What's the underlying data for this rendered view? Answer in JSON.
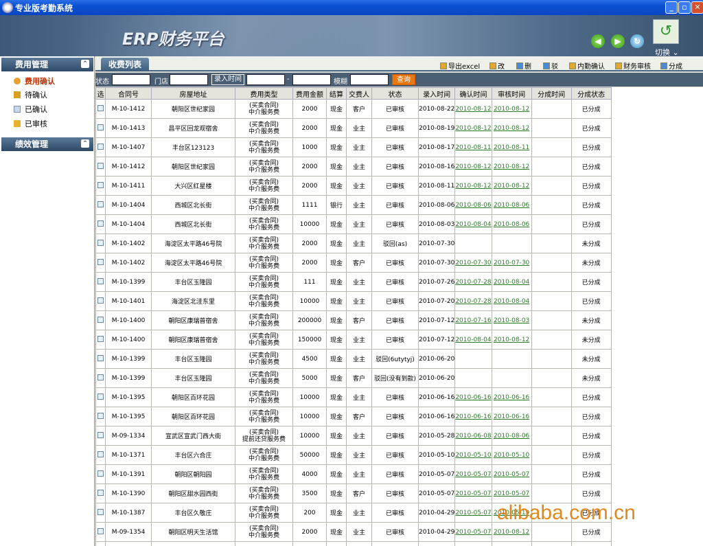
{
  "window": {
    "title": "专业版考勤系统"
  },
  "banner": {
    "brand": "ERP财务平台",
    "switch_label": "切换 ⌄"
  },
  "sidebar": {
    "sections": [
      {
        "label": "费用管理",
        "items": [
          {
            "label": "费用确认",
            "active": true
          },
          {
            "label": "待确认",
            "active": false
          },
          {
            "label": "已确认",
            "active": false
          },
          {
            "label": "已审核",
            "active": false
          }
        ]
      },
      {
        "label": "绩效管理",
        "items": []
      }
    ]
  },
  "tab": {
    "label": "收费列表"
  },
  "toolbar": [
    {
      "label": "导出excel"
    },
    {
      "label": "改"
    },
    {
      "label": "删"
    },
    {
      "label": "驳"
    },
    {
      "label": "内勤确认"
    },
    {
      "label": "财务审核"
    },
    {
      "label": "分成"
    }
  ],
  "filters": {
    "status_label": "状态",
    "store_label": "门店",
    "entry_time_label": "录入时间",
    "dash": "-",
    "fuzzy_label": "模糊",
    "query_label": "查询"
  },
  "table": {
    "headers": [
      "选",
      "合同号",
      "房屋地址",
      "费用类型",
      "费用金额",
      "结算",
      "交费人",
      "状态",
      "录入时间",
      "确认时间",
      "审核时间",
      "分成时间",
      "分成状态"
    ],
    "rows": [
      [
        "M-10-1412",
        "朝阳区世纪家园",
        "(买卖合同)\n中介服务费",
        "2000",
        "现金",
        "客户",
        "已审核",
        "2010-08-22",
        "2010-08-12",
        "2010-08-12",
        "",
        "已分成"
      ],
      [
        "M-10-1413",
        "昌平区回龙观宿舍",
        "(买卖合同)\n中介服务费",
        "2000",
        "现金",
        "业主",
        "已审核",
        "2010-08-19",
        "2010-08-12",
        "2010-08-12",
        "",
        "已分成"
      ],
      [
        "M-10-1407",
        "丰台区123123",
        "(买卖合同)\n中介服务费",
        "1000",
        "现金",
        "业主",
        "已审核",
        "2010-08-17",
        "2010-08-11",
        "2010-08-11",
        "",
        "已分成"
      ],
      [
        "M-10-1412",
        "朝阳区世纪家园",
        "(买卖合同)\n中介服务费",
        "2000",
        "现金",
        "业主",
        "已审核",
        "2010-08-16",
        "2010-08-12",
        "2010-08-12",
        "",
        "已分成"
      ],
      [
        "M-10-1411",
        "大兴区红星楼",
        "(买卖合同)\n中介服务费",
        "2000",
        "现金",
        "业主",
        "已审核",
        "2010-08-11",
        "2010-08-12",
        "2010-08-12",
        "",
        "已分成"
      ],
      [
        "M-10-1404",
        "西城区北长街",
        "(买卖合同)\n中介服务费",
        "1111",
        "银行",
        "业主",
        "已审核",
        "2010-08-06",
        "2010-08-06",
        "2010-08-06",
        "",
        "已分成"
      ],
      [
        "M-10-1404",
        "西城区北长街",
        "(买卖合同)\n中介服务费",
        "10000",
        "现金",
        "业主",
        "已审核",
        "2010-08-03",
        "2010-08-04",
        "2010-08-06",
        "",
        "已分成"
      ],
      [
        "M-10-1402",
        "海淀区太平路46号院",
        "(买卖合同)\n中介服务费",
        "2000",
        "现金",
        "业主",
        "驳回(as)",
        "2010-07-30",
        "",
        "",
        "",
        "未分成"
      ],
      [
        "M-10-1402",
        "海淀区太平路46号院",
        "(买卖合同)\n中介服务费",
        "2000",
        "现金",
        "客户",
        "已审核",
        "2010-07-30",
        "2010-07-30",
        "2010-07-30",
        "",
        "未分成"
      ],
      [
        "M-10-1399",
        "丰台区玉隆园",
        "(买卖合同)\n中介服务费",
        "111",
        "现金",
        "业主",
        "已审核",
        "2010-07-26",
        "2010-07-28",
        "2010-08-04",
        "",
        "已分成"
      ],
      [
        "M-10-1401",
        "海淀区北洼东里",
        "(买卖合同)\n中介服务费",
        "10000",
        "现金",
        "业主",
        "已审核",
        "2010-07-20",
        "2010-07-28",
        "2010-08-04",
        "",
        "已分成"
      ],
      [
        "M-10-1400",
        "朝阳区康瑞普宿舍",
        "(买卖合同)\n中介服务费",
        "200000",
        "现金",
        "客户",
        "已审核",
        "2010-07-12",
        "2010-07-16",
        "2010-08-03",
        "",
        "未分成"
      ],
      [
        "M-10-1400",
        "朝阳区康瑞普宿舍",
        "(买卖合同)\n中介服务费",
        "150000",
        "现金",
        "业主",
        "已审核",
        "2010-07-12",
        "2010-08-04",
        "2010-08-12",
        "",
        "未分成"
      ],
      [
        "M-10-1399",
        "丰台区玉隆园",
        "(买卖合同)\n中介服务费",
        "4500",
        "现金",
        "业主",
        "驳回(6utytyj)",
        "2010-06-20",
        "",
        "",
        "",
        "未分成"
      ],
      [
        "M-10-1399",
        "丰台区玉隆园",
        "(买卖合同)\n中介服务费",
        "5000",
        "现金",
        "客户",
        "驳回(没有到款)",
        "2010-06-20",
        "",
        "",
        "",
        "未分成"
      ],
      [
        "M-10-1395",
        "朝阳区百环花园",
        "(买卖合同)\n中介服务费",
        "10000",
        "现金",
        "业主",
        "已审核",
        "2010-06-16",
        "2010-06-16",
        "2010-06-16",
        "",
        "已分成"
      ],
      [
        "M-10-1395",
        "朝阳区百环花园",
        "(买卖合同)\n中介服务费",
        "10000",
        "现金",
        "客户",
        "已审核",
        "2010-06-16",
        "2010-06-16",
        "2010-06-16",
        "",
        "已分成"
      ],
      [
        "M-09-1334",
        "宣武区宣武门西大街",
        "(买卖合同)\n提前还贷服务费",
        "10000",
        "现金",
        "业主",
        "已审核",
        "2010-05-28",
        "2010-06-08",
        "2010-08-06",
        "",
        "已分成"
      ],
      [
        "M-10-1371",
        "丰台区六合庄",
        "(买卖合同)\n中介服务费",
        "50000",
        "现金",
        "业主",
        "已审核",
        "2010-05-10",
        "2010-05-10",
        "2010-05-10",
        "",
        "已分成"
      ],
      [
        "M-10-1391",
        "朝阳区朝阳园",
        "(买卖合同)\n中介服务费",
        "4000",
        "现金",
        "业主",
        "已审核",
        "2010-05-07",
        "2010-05-07",
        "2010-05-07",
        "",
        "已分成"
      ],
      [
        "M-10-1390",
        "朝阳区甜水园西街",
        "(买卖合同)\n中介服务费",
        "3500",
        "现金",
        "客户",
        "已审核",
        "2010-05-07",
        "2010-05-07",
        "2010-05-07",
        "",
        "已分成"
      ],
      [
        "M-10-1387",
        "丰台区久敬庄",
        "(买卖合同)\n中介服务费",
        "200",
        "现金",
        "业主",
        "已审核",
        "2010-04-29",
        "2010-05-07",
        "2010-05-19",
        "",
        "已分成"
      ],
      [
        "M-09-1354",
        "朝阳区明天生活馆",
        "(买卖合同)\n中介服务费",
        "2000",
        "现金",
        "业主",
        "已审核",
        "2010-04-29",
        "2010-05-07",
        "2010-08-12",
        "",
        "已分成"
      ],
      [
        "",
        "",
        "(买卖合同)",
        "",
        "",
        "",
        "",
        "",
        "",
        "",
        "",
        ""
      ]
    ]
  },
  "watermark": "alibaba.com.cn"
}
